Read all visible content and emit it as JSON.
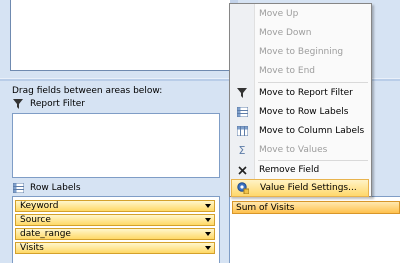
{
  "drag_instruction": "Drag fields between areas below:",
  "areas": {
    "report_filter": "Report Filter",
    "row_labels": "Row Labels"
  },
  "row_fields": [
    "Keyword",
    "Source",
    "date_range",
    "Visits"
  ],
  "values_field": "Sum of Visits",
  "menu": {
    "items": [
      {
        "label": "Move Up",
        "enabled": false
      },
      {
        "label": "Move Down",
        "enabled": false
      },
      {
        "label": "Move to Beginning",
        "enabled": false
      },
      {
        "label": "Move to End",
        "enabled": false
      },
      {
        "label": "Move to Report Filter",
        "enabled": true,
        "icon": "filter-icon"
      },
      {
        "label": "Move to Row Labels",
        "enabled": true,
        "icon": "row-labels-icon"
      },
      {
        "label": "Move to Column Labels",
        "enabled": true,
        "icon": "column-labels-icon"
      },
      {
        "label": "Move to Values",
        "enabled": false,
        "icon": "sigma-icon"
      },
      {
        "label": "Remove Field",
        "enabled": true,
        "icon": "remove-icon"
      },
      {
        "label": "Value Field Settings...",
        "enabled": true,
        "icon": "settings-icon",
        "highlighted": true
      }
    ]
  },
  "colors": {
    "panel_bg": "#d6e3f3",
    "menu_highlight": "#ffd86b",
    "field_pill": "#ffd866"
  }
}
